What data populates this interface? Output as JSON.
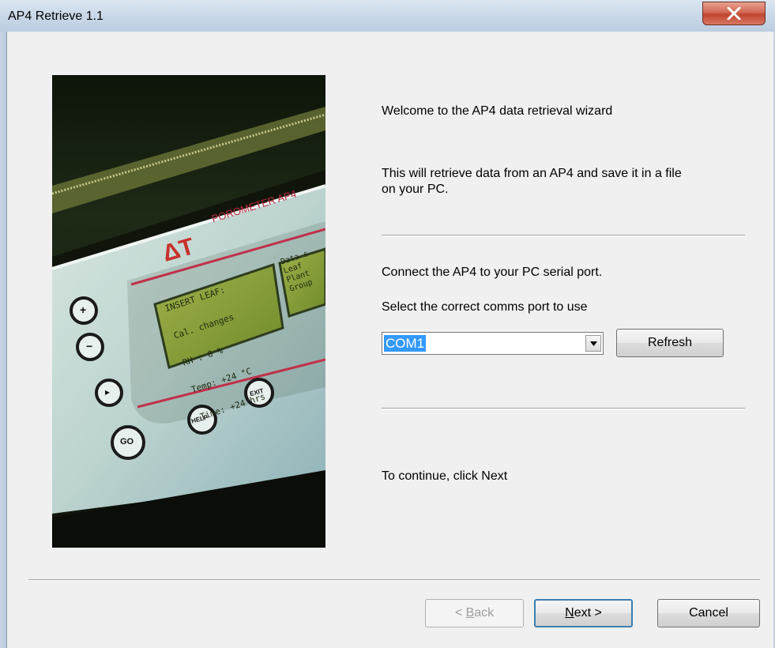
{
  "window": {
    "title": "AP4 Retrieve 1.1"
  },
  "wizard": {
    "welcome": "Welcome to the AP4 data retrieval wizard",
    "description_line1": "This will retrieve data from an AP4 and save it in a file",
    "description_line2": "on your PC.",
    "connect": "Connect the AP4 to your PC serial port.",
    "select_prompt": "Select the correct comms port to use",
    "continue_hint": "To continue, click Next"
  },
  "port": {
    "selected": "COM1"
  },
  "buttons": {
    "refresh": "Refresh",
    "back_prefix": "< ",
    "back_key": "B",
    "back_rest": "ack",
    "next_key": "N",
    "next_rest": "ext >",
    "cancel": "Cancel"
  },
  "photo": {
    "brand": "ΔT",
    "model": "POROMETER AP4",
    "lcd_line1": "INSERT LEAF:",
    "lcd_line2": "Cal. changes",
    "lcd_line3": "RH : 0 %",
    "lcd_line4": "Temp: +24 °C",
    "lcd_line5": "Time: +24 hrs",
    "lcd_right1": "Data s",
    "lcd_right2": "Leaf",
    "lcd_right3": "Plant",
    "lcd_right4": "Group",
    "key_plus": "+",
    "key_minus": "−",
    "key_arrow": "▸",
    "key_go": "GO",
    "key_help": "HELP",
    "key_exit": "EXIT"
  }
}
